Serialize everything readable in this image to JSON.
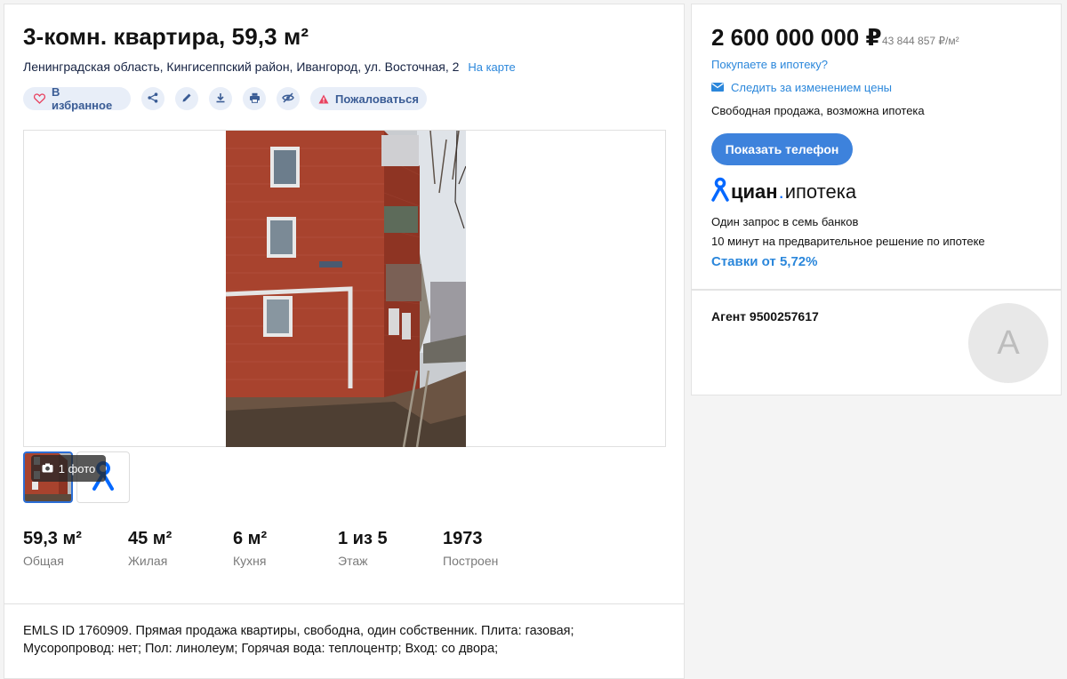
{
  "listing": {
    "title": "3-комн. квартира, 59,3 м²",
    "address": "Ленинградская область, Кингисеппский район, Ивангород, ул. Восточная, 2",
    "map_link": "На карте"
  },
  "actions": {
    "favorite_label": "В избранное",
    "complain_label": "Пожаловаться",
    "icons": [
      "heart-icon",
      "share-icon",
      "edit-icon",
      "download-icon",
      "print-icon",
      "hide-icon",
      "warning-icon"
    ]
  },
  "gallery": {
    "photo_count": "1 фото"
  },
  "stats": [
    {
      "value": "59,3 м²",
      "label": "Общая"
    },
    {
      "value": "45 м²",
      "label": "Жилая"
    },
    {
      "value": "6 м²",
      "label": "Кухня"
    },
    {
      "value": "1 из 5",
      "label": "Этаж"
    },
    {
      "value": "1973",
      "label": "Построен"
    }
  ],
  "description": "EMLS ID 1760909. Прямая продажа квартиры, свободна, один собственник. Плита: газовая; Мусоропровод: нет; Пол: линолеум; Горячая вода: теплоцентр; Вход: со двора;",
  "price": {
    "value": "2 600 000 000 ₽",
    "per_meter": "43 844 857 ₽/м²",
    "mortgage_question": "Покупаете в ипотеку?",
    "watch_label": "Следить за изменением цены",
    "sale_type": "Свободная продажа, возможна ипотека",
    "phone_button": "Показать телефон"
  },
  "mortgage": {
    "logo_part1": "циан",
    "logo_part2": "ипотека",
    "line1": "Один запрос в семь банков",
    "line2": "10 минут на предварительное решение по ипотеке",
    "rates": "Ставки от 5,72%"
  },
  "agent": {
    "name": "Агент 9500257617",
    "avatar_letter": "А"
  },
  "colors": {
    "accent": "#2b87db",
    "button": "#3d82dc",
    "pill_bg": "#e8eef8",
    "warning": "#e84260"
  }
}
